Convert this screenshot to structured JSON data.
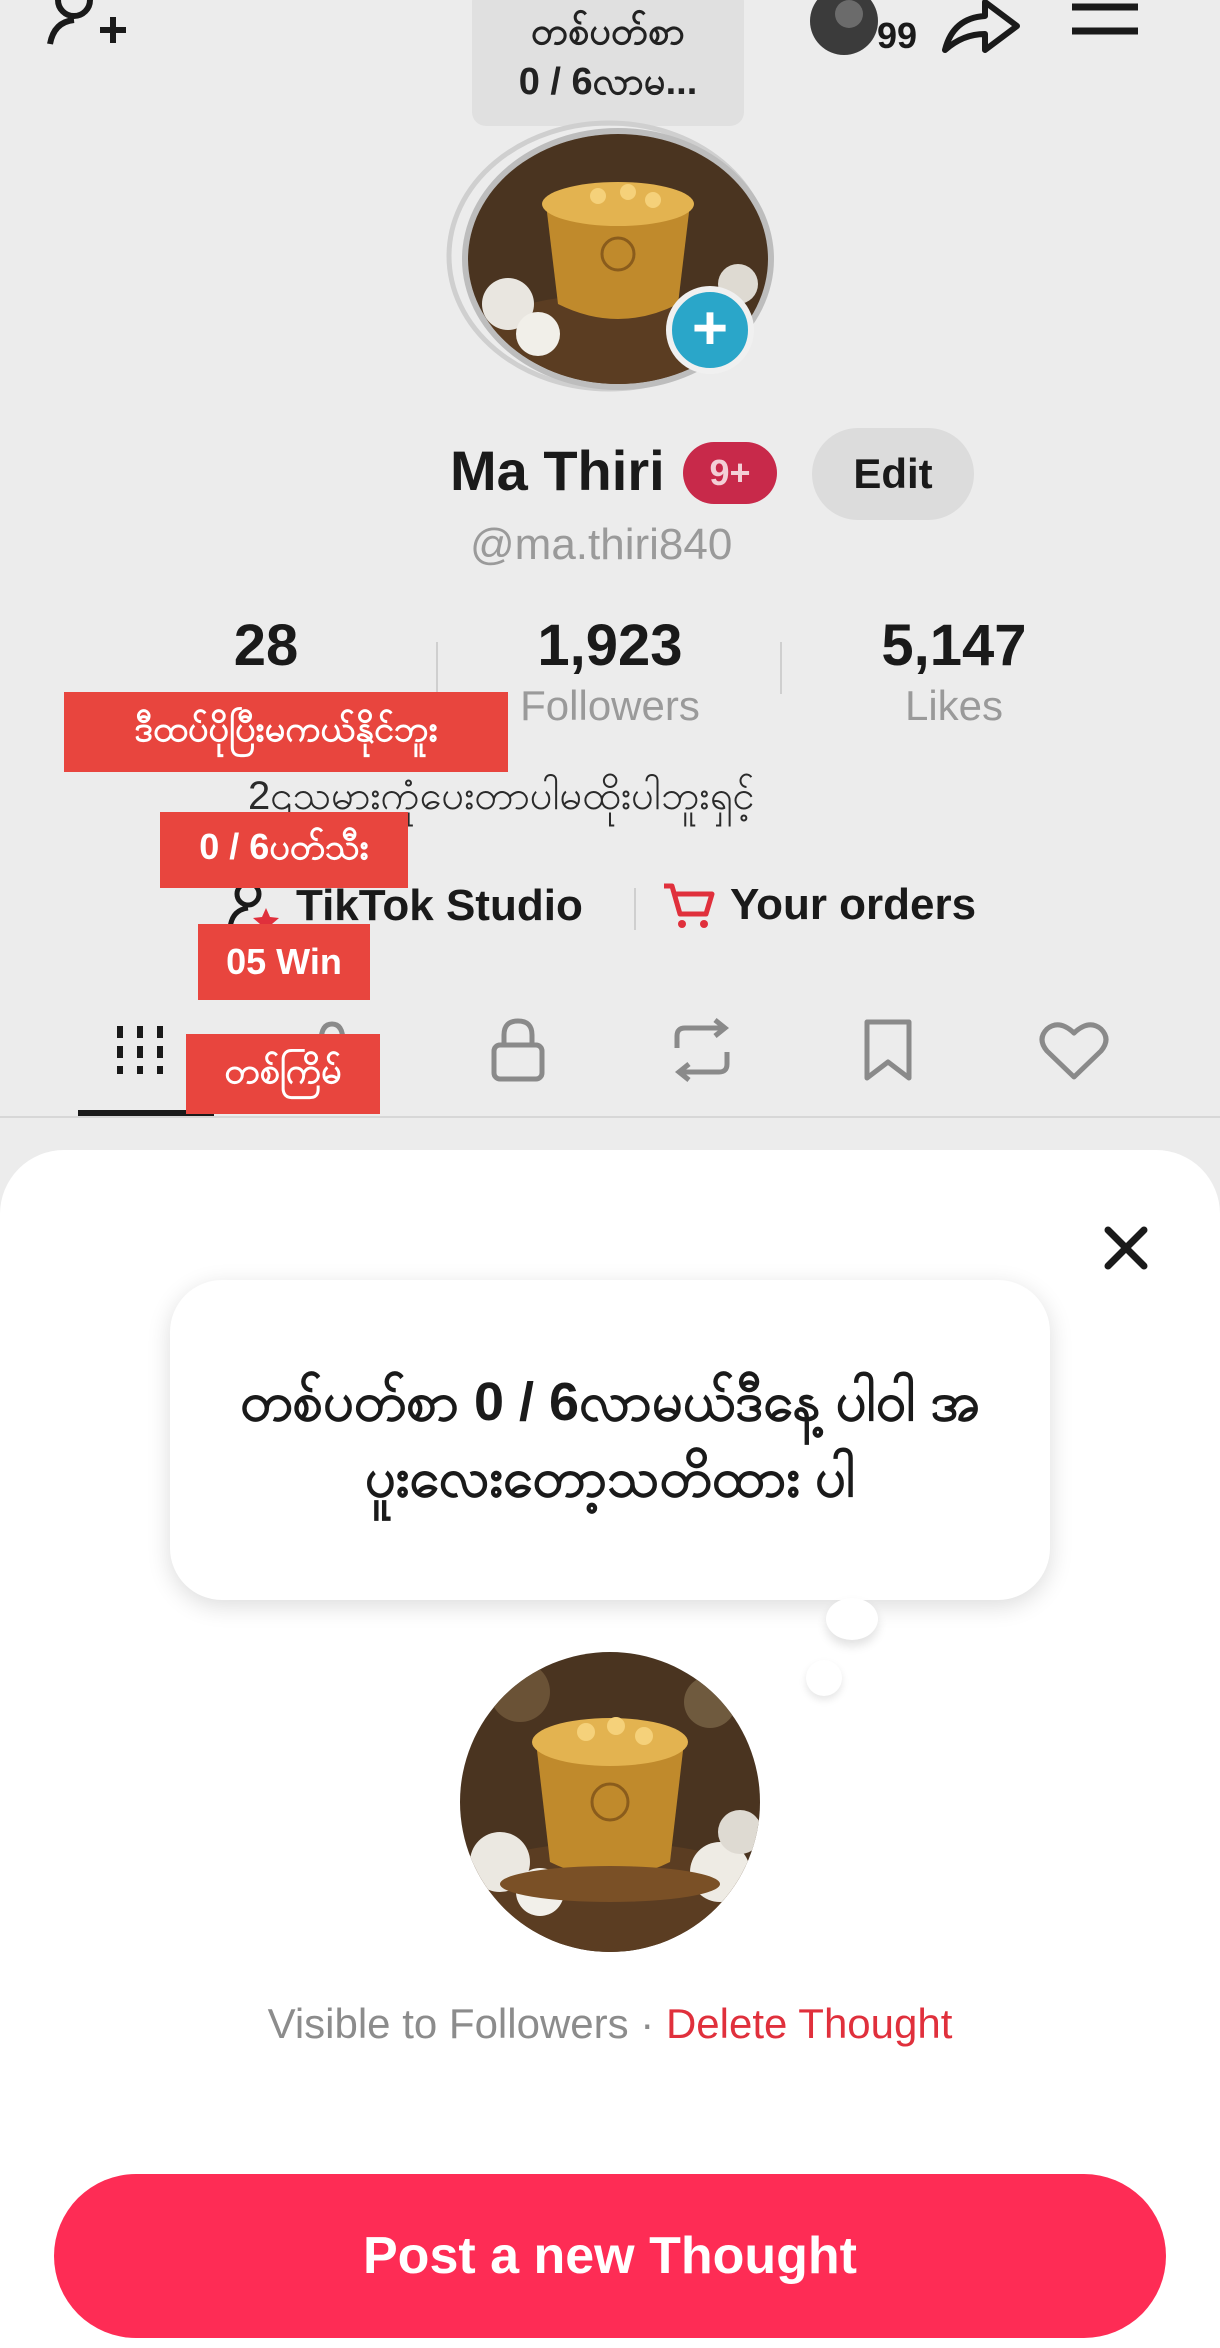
{
  "thought_preview": {
    "line1": "တစ်ပတ်စာ",
    "line2": "0 / 6လာမ..."
  },
  "top_bar": {
    "avatar_count": "99"
  },
  "profile": {
    "name": "Ma Thiri",
    "name_badge": "9+",
    "edit_label": "Edit",
    "handle": "@ma.thiri840",
    "bio": "2၎သမားကုံပေးတာပါမထိုးပါဘူးရှင့်"
  },
  "stats": [
    {
      "value": "28",
      "label": ""
    },
    {
      "value": "1,923",
      "label": "Followers"
    },
    {
      "value": "5,147",
      "label": "Likes"
    }
  ],
  "links": {
    "studio": "TikTok Studio",
    "orders": "Your orders"
  },
  "overlay_labels": {
    "label1": "ဒီထပ်ပိုပြီးမကယ်နိုင်ဘူး",
    "label2": "0 / 6ပတ်သီး",
    "label3": "05 Win",
    "label4": "တစ်ကြိမ်"
  },
  "sheet": {
    "thought_text": "တစ်ပတ်စာ  0 / 6လာမယ်ဒီနေ့ ပါဝါ အပူးလေးတော့သတိထား ပါ",
    "visibility": "Visible to Followers",
    "separator": "·",
    "delete_label": "Delete Thought",
    "post_button": "Post a new Thought"
  },
  "colors": {
    "accent": "#fe2c55",
    "badge": "#2aa6c9",
    "label_red": "#e8453e"
  }
}
